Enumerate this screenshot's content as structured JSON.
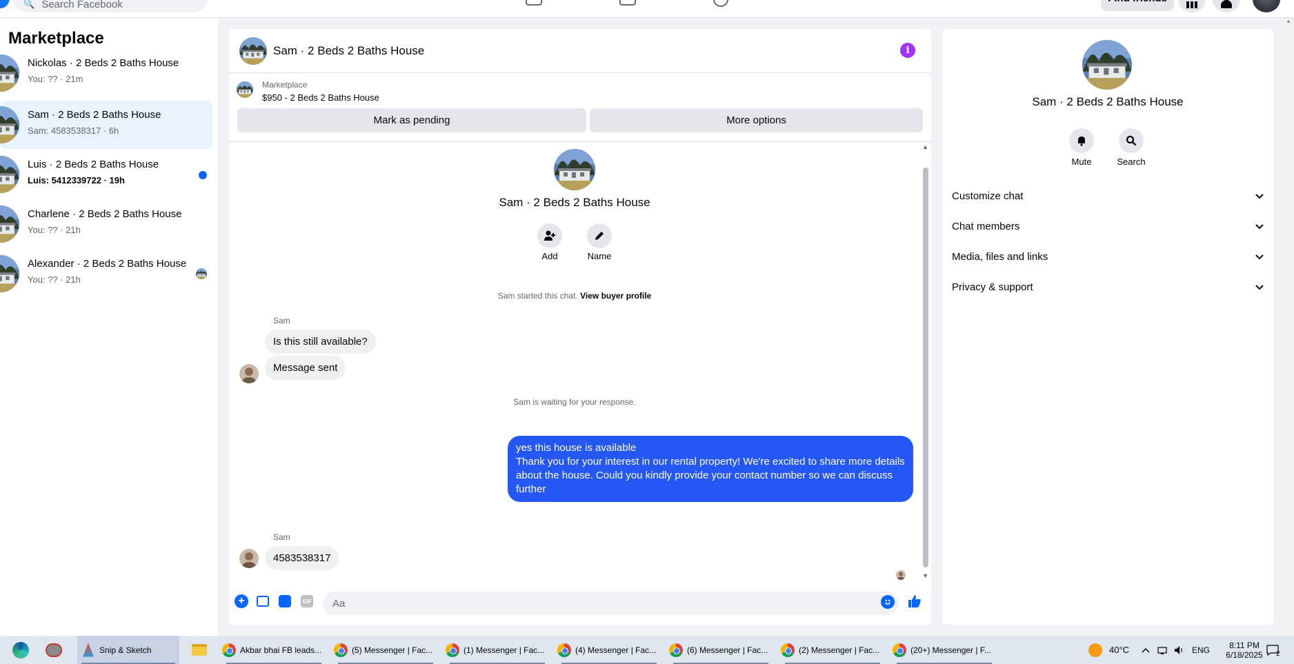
{
  "topbar": {
    "search_placeholder": "Search Facebook",
    "find_friends": "Find friends"
  },
  "sidebar": {
    "title": "Marketplace",
    "conversations": [
      {
        "name": "Nickolas · 2 Beds 2 Baths House",
        "preview": "You: ?? · 21m",
        "unread": false
      },
      {
        "name": "Sam · 2 Beds 2 Baths House",
        "preview": "Sam: 4583538317 · 6h",
        "unread": false
      },
      {
        "name": "Luis · 2 Beds 2 Baths House",
        "preview": "Luis: 5412339722 · 19h",
        "unread": true
      },
      {
        "name": "Charlene · 2 Beds 2 Baths House",
        "preview": "You: ?? · 21h",
        "unread": false
      },
      {
        "name": "Alexander · 2 Beds 2 Baths House",
        "preview": "You: ?? · 21h",
        "unread": false
      }
    ]
  },
  "chat": {
    "title": "Sam · 2 Beds 2 Baths House",
    "listing_label": "Marketplace",
    "listing_price": "$950 - 2 Beds 2 Baths House",
    "mark_pending": "Mark as pending",
    "more_options": "More options",
    "intro_title": "Sam · 2 Beds 2 Baths House",
    "add_label": "Add",
    "name_label": "Name",
    "started_text": "Sam started this chat.",
    "view_profile": "View buyer profile",
    "sender_1": "Sam",
    "msg_1": "Is this still available?",
    "msg_2": "Message sent",
    "waiting": "Sam is waiting for your response.",
    "reply": "yes this house is available\nThank you for your interest in our rental property! We're excited to share more details about the house. Could you kindly provide your contact number so we can discuss further",
    "sender_2": "Sam",
    "msg_3": "4583538317",
    "composer_placeholder": "Aa"
  },
  "details": {
    "title": "Sam · 2 Beds 2 Baths House",
    "mute": "Mute",
    "search": "Search",
    "sections": [
      "Customize chat",
      "Chat members",
      "Media, files and links",
      "Privacy & support"
    ]
  },
  "taskbar": {
    "snip": "Snip & Sketch",
    "tabs": [
      "Akbar bhai FB leads...",
      "(5) Messenger | Fac...",
      "(1) Messenger | Fac...",
      "(4) Messenger | Fac...",
      "(6) Messenger | Fac...",
      "(2) Messenger | Fac...",
      "(20+) Messenger | F..."
    ],
    "weather": "40°C",
    "lang": "ENG",
    "time": "8:11 PM",
    "date": "6/18/2025",
    "notif_count": "2"
  },
  "colors": {
    "accent": "#0866ff",
    "outgoing_bubble": "#2457f5",
    "info": "#a033ff",
    "selected_row": "#e7f3ff"
  }
}
